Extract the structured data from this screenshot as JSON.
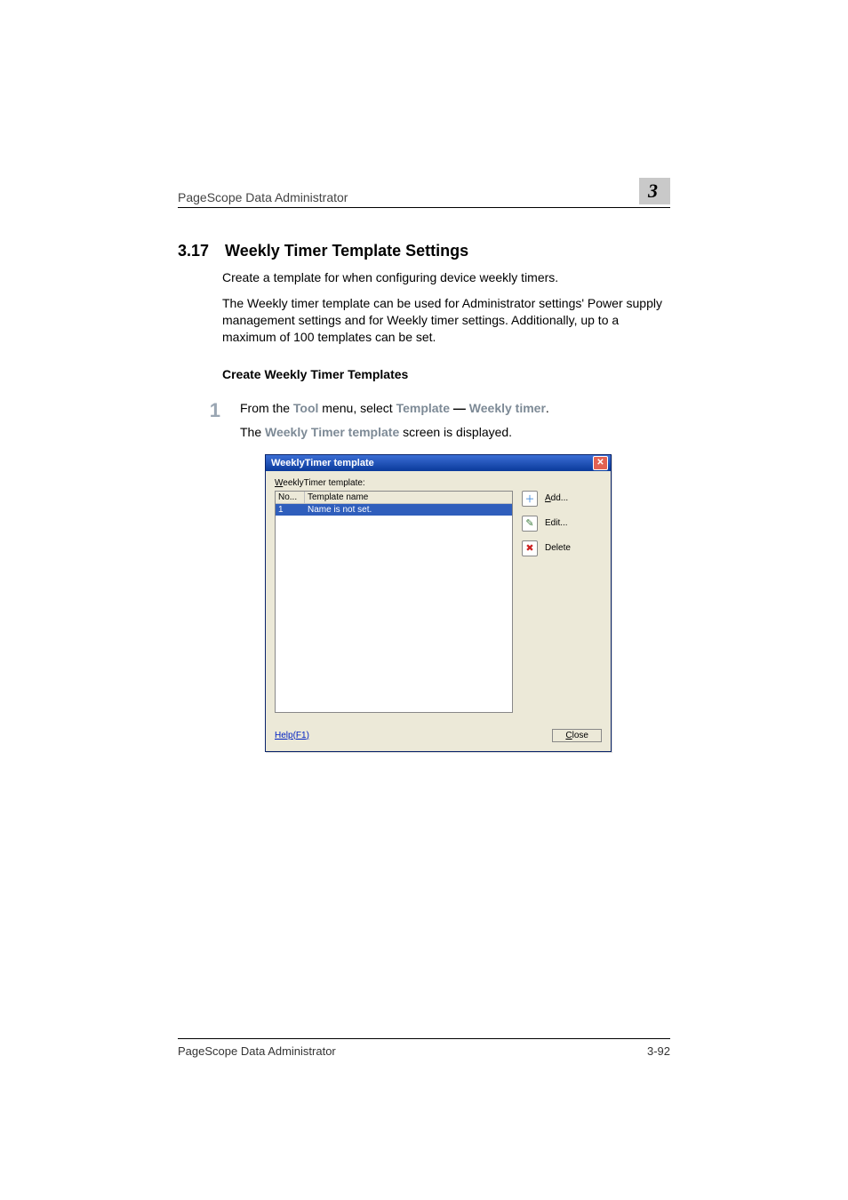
{
  "header": {
    "doc_title": "PageScope Data Administrator",
    "chapter_num": "3"
  },
  "section": {
    "number": "3.17",
    "title": "Weekly Timer Template Settings",
    "para1": "Create a template for when configuring device weekly timers.",
    "para2": "The Weekly timer template can be used for Administrator settings' Power supply management settings and for Weekly timer settings. Additionally, up to a maximum of 100 templates can be set."
  },
  "subheading": "Create Weekly Timer Templates",
  "step": {
    "num": "1",
    "line1_pre": "From the ",
    "line1_tool": "Tool",
    "line1_mid": " menu, select ",
    "line1_template": "Template",
    "line1_dash": " — ",
    "line1_weekly": "Weekly timer",
    "line1_post": ".",
    "line2_pre": "The ",
    "line2_bold": "Weekly Timer template",
    "line2_post": " screen is displayed."
  },
  "dialog": {
    "title": "WeeklyTimer template",
    "group_label_pre": "W",
    "group_label_rest": "eeklyTimer template:",
    "col_no": "No...",
    "col_name": "Template name",
    "row1_no": "1",
    "row1_name": "Name is not set.",
    "btn_add_pre": "A",
    "btn_add_rest": "dd...",
    "btn_edit_label": "Edit...",
    "btn_delete_label": "Delete",
    "help_label": "Help(F1)",
    "close_pre": "C",
    "close_rest": "lose"
  },
  "footer": {
    "left": "PageScope Data Administrator",
    "right": "3-92"
  }
}
